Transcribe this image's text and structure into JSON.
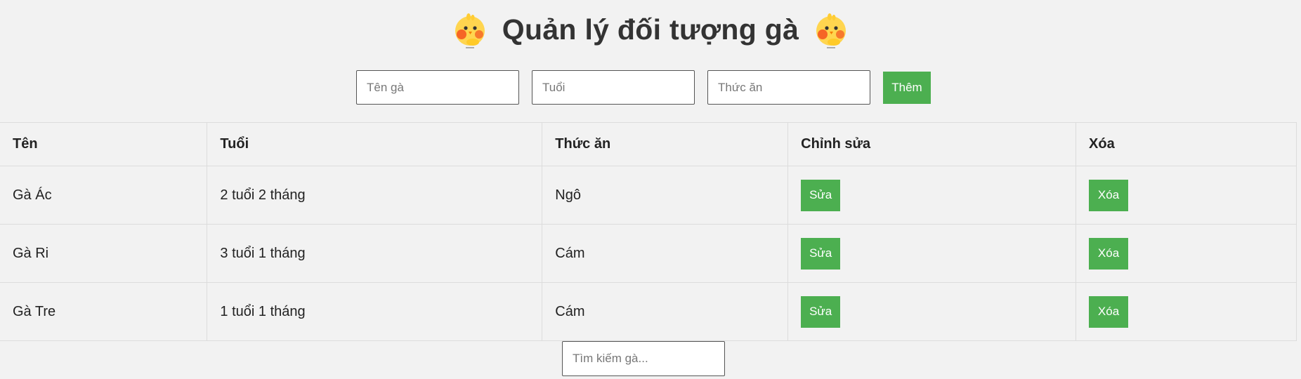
{
  "header": {
    "title": "Quản lý đối tượng gà",
    "icon": "chick-icon"
  },
  "form": {
    "name_placeholder": "Tên gà",
    "age_placeholder": "Tuổi",
    "food_placeholder": "Thức ăn",
    "add_label": "Thêm"
  },
  "table": {
    "columns": [
      "Tên",
      "Tuổi",
      "Thức ăn",
      "Chỉnh sửa",
      "Xóa"
    ],
    "rows": [
      {
        "name": "Gà Ác",
        "age": "2 tuổi 2 tháng",
        "food": "Ngô",
        "edit": "Sửa",
        "delete": "Xóa"
      },
      {
        "name": "Gà Ri",
        "age": "3 tuổi 1 tháng",
        "food": "Cám",
        "edit": "Sửa",
        "delete": "Xóa"
      },
      {
        "name": "Gà Tre",
        "age": "1 tuổi 1 tháng",
        "food": "Cám",
        "edit": "Sửa",
        "delete": "Xóa"
      }
    ]
  },
  "search": {
    "placeholder": "Tìm kiếm gà..."
  },
  "colors": {
    "accent": "#4caf50",
    "background": "#f2f2f2",
    "chick_body": "#ffd54f",
    "chick_cheek": "#f4511e"
  }
}
